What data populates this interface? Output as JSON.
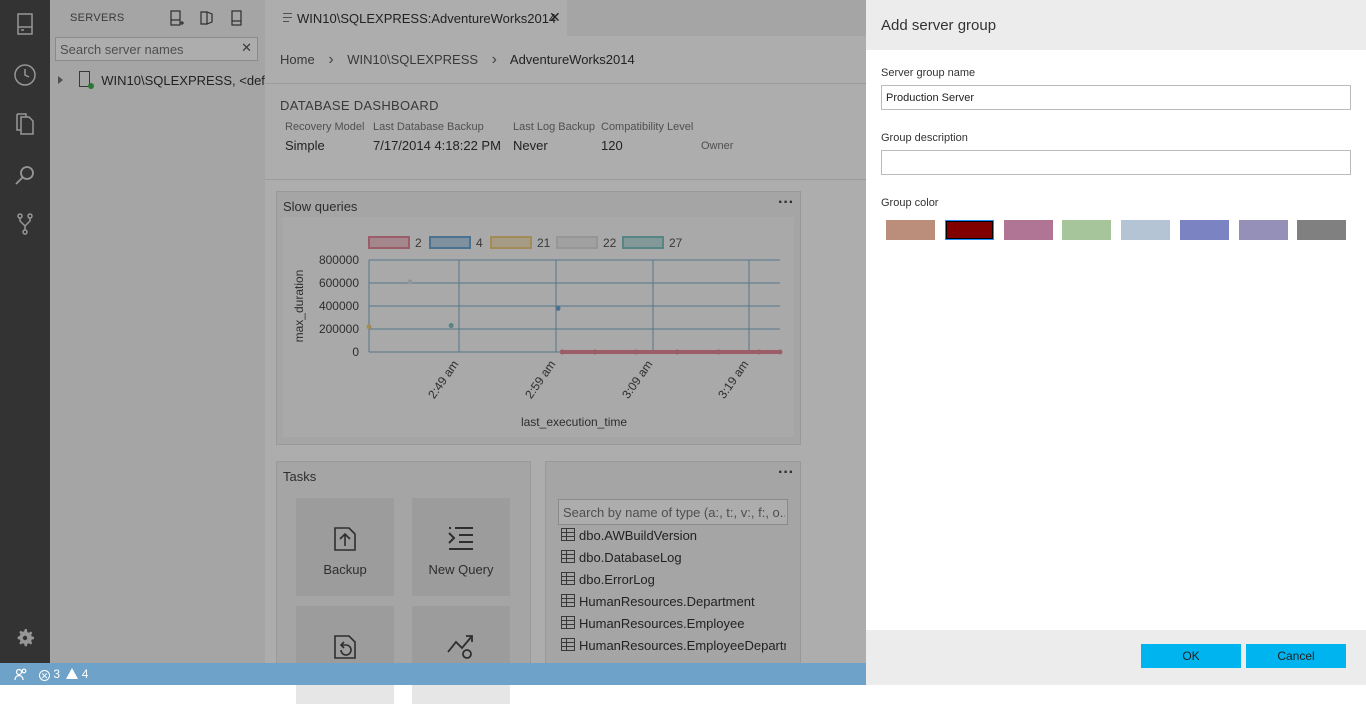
{
  "servers": {
    "title": "SERVERS",
    "search_placeholder": "Search server names",
    "search_clear": "✕",
    "tree_item": "WIN10\\SQLEXPRESS, <def..."
  },
  "editor": {
    "tab_title": "WIN10\\SQLEXPRESS:AdventureWorks2014",
    "tab_close": "✕",
    "breadcrumb": [
      "Home",
      "WIN10\\SQLEXPRESS",
      "AdventureWorks2014"
    ],
    "dashboard_title": "DATABASE DASHBOARD",
    "properties": [
      {
        "label": "Recovery Model",
        "value": "Simple"
      },
      {
        "label": "Last Database Backup",
        "value": "7/17/2014 4:18:22 PM"
      },
      {
        "label": "Last Log Backup",
        "value": "Never"
      },
      {
        "label": "Compatibility Level",
        "value": "120"
      },
      {
        "label": "",
        "value": "Owner"
      }
    ],
    "slow_queries": {
      "title": "Slow queries",
      "more": "···"
    },
    "tasks": {
      "title": "Tasks",
      "items": [
        {
          "label": "Backup"
        },
        {
          "label": "New Query"
        },
        {
          "label": ""
        },
        {
          "label": ""
        }
      ]
    },
    "objects": {
      "more": "···",
      "search_placeholder": "Search by name of type (a:, t:, v:, f:, o...",
      "items": [
        "dbo.AWBuildVersion",
        "dbo.DatabaseLog",
        "dbo.ErrorLog",
        "HumanResources.Department",
        "HumanResources.Employee",
        "HumanResources.EmployeeDepartme"
      ]
    }
  },
  "chart_data": {
    "type": "scatter",
    "xlabel": "last_execution_time",
    "ylabel": "max_duration",
    "ylim": [
      0,
      800000
    ],
    "yticks": [
      0,
      200000,
      400000,
      600000,
      800000
    ],
    "xticks": [
      "2:49 am",
      "2:59 am",
      "3:09 am",
      "3:19 am"
    ],
    "grid": true,
    "legend_position": "top",
    "series": [
      {
        "name": "2",
        "color": "#e58a9a",
        "points": [
          {
            "x": 0.47,
            "y": 0
          },
          {
            "x": 0.55,
            "y": 0
          },
          {
            "x": 0.65,
            "y": 0
          },
          {
            "x": 0.75,
            "y": 0
          },
          {
            "x": 0.85,
            "y": 0
          },
          {
            "x": 0.95,
            "y": 0
          },
          {
            "x": 1.0,
            "y": 0
          }
        ]
      },
      {
        "name": "4",
        "color": "#6ea9d6",
        "points": [
          {
            "x": 0.46,
            "y": 380000
          }
        ]
      },
      {
        "name": "21",
        "color": "#f0cd80",
        "points": [
          {
            "x": 0.0,
            "y": 220000
          }
        ]
      },
      {
        "name": "22",
        "color": "#dddddd",
        "points": [
          {
            "x": 0.1,
            "y": 610000
          }
        ]
      },
      {
        "name": "27",
        "color": "#7fc4c4",
        "points": [
          {
            "x": 0.2,
            "y": 230000
          }
        ]
      }
    ]
  },
  "statusbar": {
    "errors": "3",
    "warnings": "4"
  },
  "dialog": {
    "title": "Add server group",
    "name_label": "Server group name",
    "name_value": "Production Server",
    "description_label": "Group description",
    "description_value": "",
    "color_label": "Group color",
    "colors": [
      "#bb8e7c",
      "#800000",
      "#b07495",
      "#a7c59a",
      "#b5c4d5",
      "#7c83c3",
      "#9590b8",
      "#808080"
    ],
    "selected_color_index": 1,
    "ok_label": "OK",
    "cancel_label": "Cancel"
  }
}
